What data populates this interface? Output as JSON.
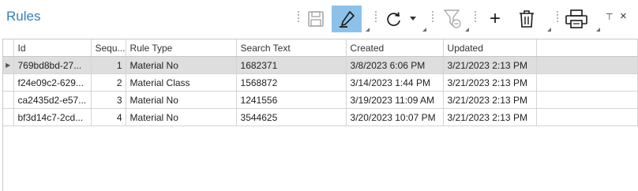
{
  "panel": {
    "title": "Rules"
  },
  "toolbar": {
    "save_icon": "save-icon",
    "edit_icon": "pencil-edit-icon",
    "refresh_icon": "refresh-icon",
    "refresh_dropdown_icon": "chevron-down-icon",
    "filter_icon": "filter-clear-icon",
    "add_label": "+",
    "delete_icon": "trash-icon",
    "print_icon": "printer-icon",
    "pin_label": "⊤",
    "close_label": "×",
    "edit_active_color": "#8cc2ea"
  },
  "grid": {
    "columns": [
      "Id",
      "Sequ...",
      "Rule Type",
      "Search Text",
      "Created",
      "Updated"
    ],
    "rows": [
      {
        "id": "769bd8bd-27...",
        "seq": "1",
        "rule_type": "Material No",
        "search_text": "1682371",
        "created": "3/8/2023 6:06 PM",
        "updated": "3/21/2023 2:13 PM",
        "selected": true
      },
      {
        "id": "f24e09c2-629...",
        "seq": "2",
        "rule_type": "Material Class",
        "search_text": "1568872",
        "created": "3/14/2023 1:44 PM",
        "updated": "3/21/2023 2:13 PM"
      },
      {
        "id": "ca2435d2-e57...",
        "seq": "3",
        "rule_type": "Material No",
        "search_text": "1241556",
        "created": "3/19/2023 11:09 AM",
        "updated": "3/21/2023 2:13 PM"
      },
      {
        "id": "bf3d14c7-2cd...",
        "seq": "4",
        "rule_type": "Material No",
        "search_text": "3544625",
        "created": "3/20/2023 10:07 PM",
        "updated": "3/21/2023 2:13 PM"
      }
    ]
  }
}
